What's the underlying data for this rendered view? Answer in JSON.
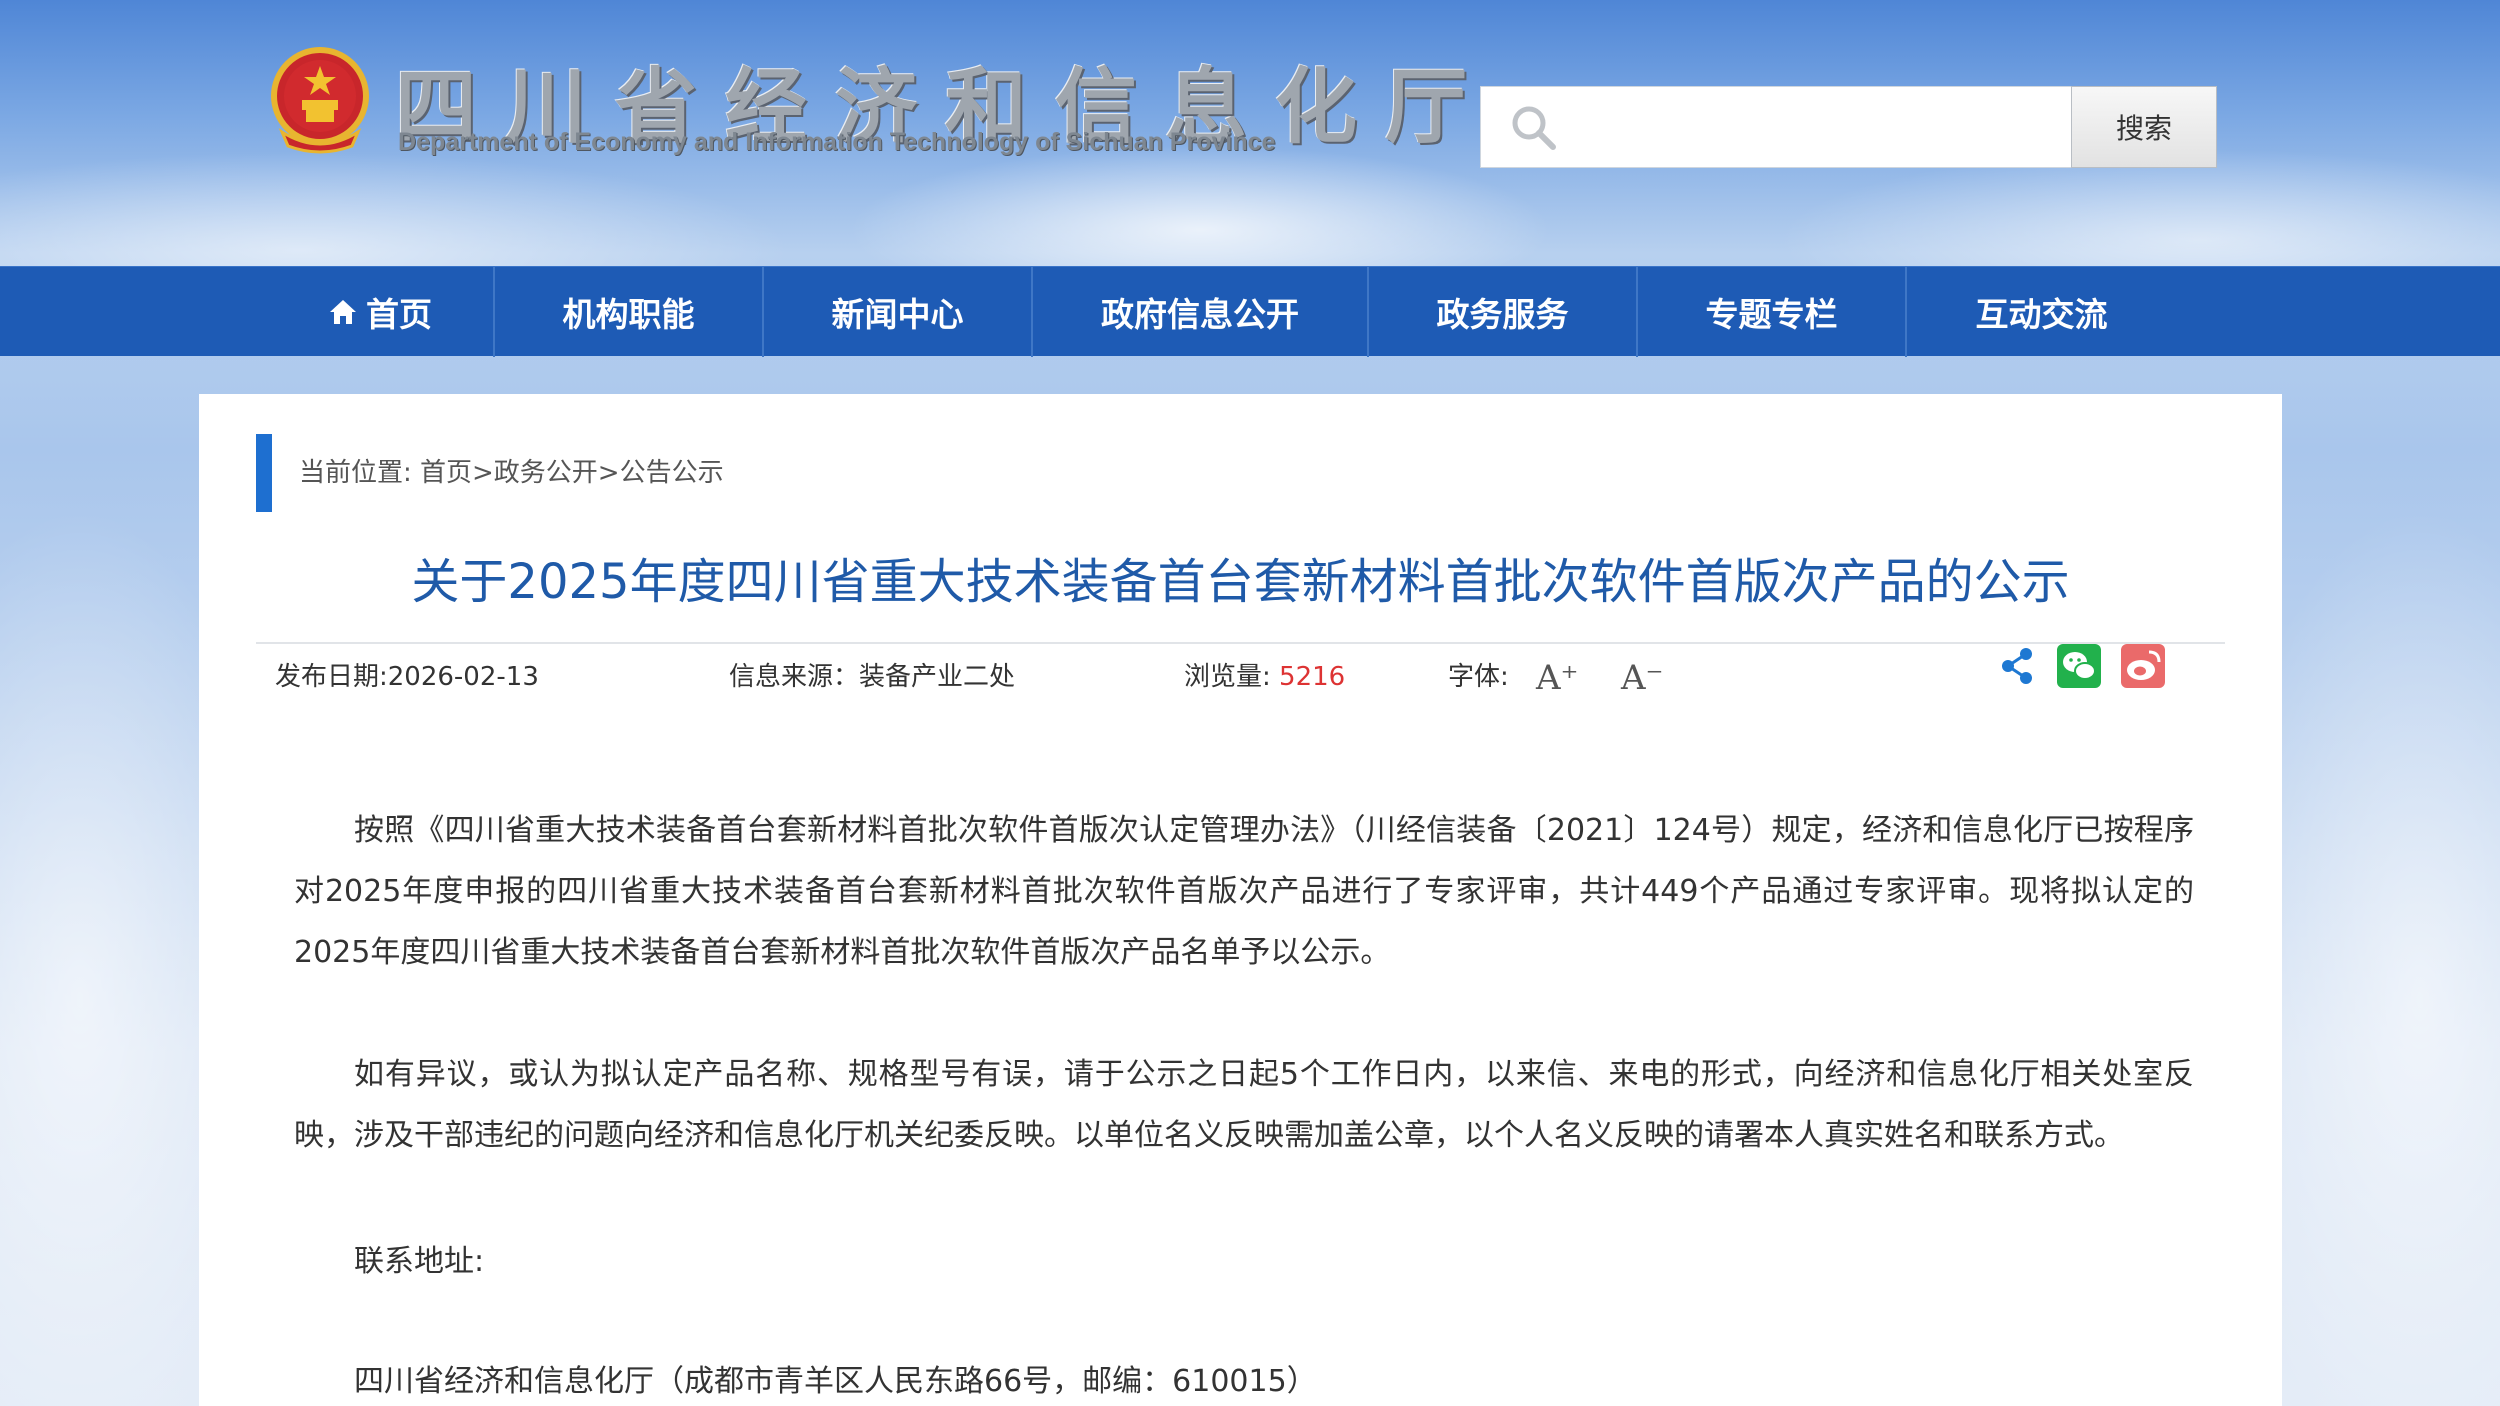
{
  "header": {
    "site_title": "四川省经济和信息化厅",
    "site_subtitle": "Department of Economy and Information Technology of Sichuan Province",
    "search_placeholder": "",
    "search_button_label": "搜索"
  },
  "nav": {
    "items": [
      {
        "label": "首页",
        "icon": "home-icon"
      },
      {
        "label": "机构职能"
      },
      {
        "label": "新闻中心"
      },
      {
        "label": "政府信息公开"
      },
      {
        "label": "政务服务"
      },
      {
        "label": "专题专栏"
      },
      {
        "label": "互动交流"
      }
    ]
  },
  "breadcrumb": {
    "text": "当前位置: 首页>政务公开>公告公示"
  },
  "article": {
    "title": "关于2025年度四川省重大技术装备首台套新材料首批次软件首版次产品的公示",
    "meta": {
      "publish_date": "发布日期:2026-02-13",
      "source": "信息来源：装备产业二处",
      "views_label": "浏览量: ",
      "views_value": "5216",
      "font_label": "字体:",
      "font_increase": "A⁺",
      "font_decrease": "A⁻"
    },
    "share_icons": [
      "share-icon",
      "wechat-icon",
      "weibo-icon"
    ],
    "paragraphs": [
      "按照《四川省重大技术装备首台套新材料首批次软件首版次认定管理办法》（川经信装备〔2021〕124号）规定，经济和信息化厅已按程序对2025年度申报的四川省重大技术装备首台套新材料首批次软件首版次产品进行了专家评审，共计449个产品通过专家评审。现将拟认定的2025年度四川省重大技术装备首台套新材料首批次软件首版次产品名单予以公示。",
      "如有异议，或认为拟认定产品名称、规格型号有误，请于公示之日起5个工作日内，以来信、来电的形式，向经济和信息化厅相关处室反映，涉及干部违纪的问题向经济和信息化厅机关纪委反映。以单位名义反映需加盖公章，以个人名义反映的请署本人真实姓名和联系方式。"
    ],
    "contact_label": "联系地址:",
    "contact_address": "四川省经济和信息化厅（成都市青羊区人民东路66号，邮编：610015）"
  },
  "colors": {
    "nav_bg": "#1e5bb5",
    "title_color": "#1f5aa8",
    "views_color": "#d33333",
    "accent_bar": "#1e6fd0"
  }
}
